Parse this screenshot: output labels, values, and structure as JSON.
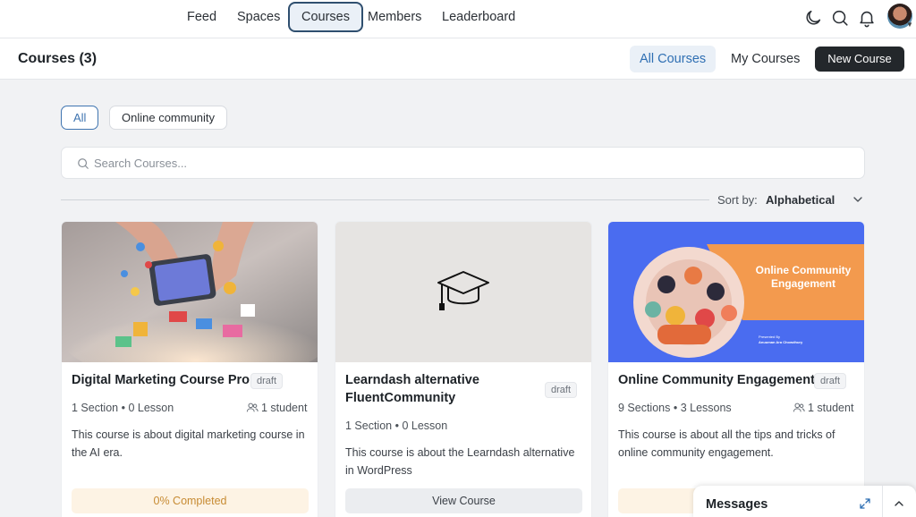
{
  "nav": {
    "tabs": [
      {
        "label": "Feed"
      },
      {
        "label": "Spaces"
      },
      {
        "label": "Courses"
      },
      {
        "label": "Members"
      },
      {
        "label": "Leaderboard"
      }
    ],
    "active_tab": "Courses"
  },
  "header": {
    "title": "Courses (3)",
    "all_courses": "All Courses",
    "my_courses": "My Courses",
    "new_course": "New Course"
  },
  "filters": {
    "all": "All",
    "online_community": "Online community"
  },
  "search": {
    "placeholder": "Search Courses..."
  },
  "sort": {
    "label": "Sort by:",
    "value": "Alphabetical"
  },
  "courses": [
    {
      "title": "Digital Marketing Course Pro",
      "status": "draft",
      "meta": "1 Section • 0 Lesson",
      "students": "1 student",
      "description": "This course is about digital marketing course in the AI era.",
      "action": "0% Completed",
      "progress_percent": 0
    },
    {
      "title": "Learndash alternative FluentCommunity",
      "status": "draft",
      "meta": "1 Section • 0 Lesson",
      "description": "This course is about the Learndash alternative in WordPress",
      "action": "View Course"
    },
    {
      "title": "Online Community Engagement",
      "status": "draft",
      "meta": "9 Sections • 3 Lessons",
      "students": "1 student",
      "description": "This course is about all the tips and tricks of online community engagement.",
      "action": "0% Completed",
      "cover_heading": "Online Community Engagement",
      "cover_presenter_label": "Presented By",
      "cover_presenter_name": "Anuuman Ara Chowdhury"
    }
  ],
  "messages": {
    "title": "Messages"
  },
  "colors": {
    "accent": "#3f74b0",
    "nav_active_border": "#2f4f6f",
    "dark_button": "#23272b",
    "progress_bg": "#fdf3e4",
    "progress_text": "#c78b33",
    "cover_blue": "#4a6cf0",
    "cover_orange": "#f39a4e"
  }
}
